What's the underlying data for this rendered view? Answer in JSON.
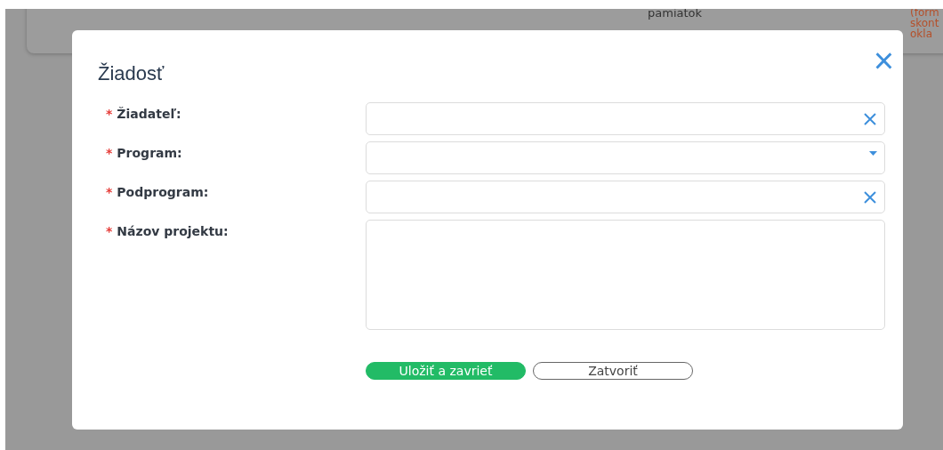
{
  "background": {
    "texts": [
      {
        "text": "pamiatok",
        "kind": "plain"
      },
      {
        "text": "(form",
        "kind": "accent"
      },
      {
        "text": "skont",
        "kind": "accent"
      },
      {
        "text": "okla",
        "kind": "accent"
      }
    ]
  },
  "dialog": {
    "title": "Žiadosť",
    "close": "×",
    "fields": [
      {
        "mark": "*",
        "label": "Žiadateľ:",
        "kind": "clearable"
      },
      {
        "mark": "*",
        "label": "Program:",
        "kind": "select"
      },
      {
        "mark": "*",
        "label": "Podprogram:",
        "kind": "clearable"
      },
      {
        "mark": "*",
        "label": "Názov projektu:",
        "kind": "textarea"
      }
    ],
    "buttons": [
      {
        "label": "Uložiť a zavrieť",
        "kind": "primary"
      },
      {
        "label": "Zatvoriť",
        "kind": "secondary"
      }
    ]
  }
}
